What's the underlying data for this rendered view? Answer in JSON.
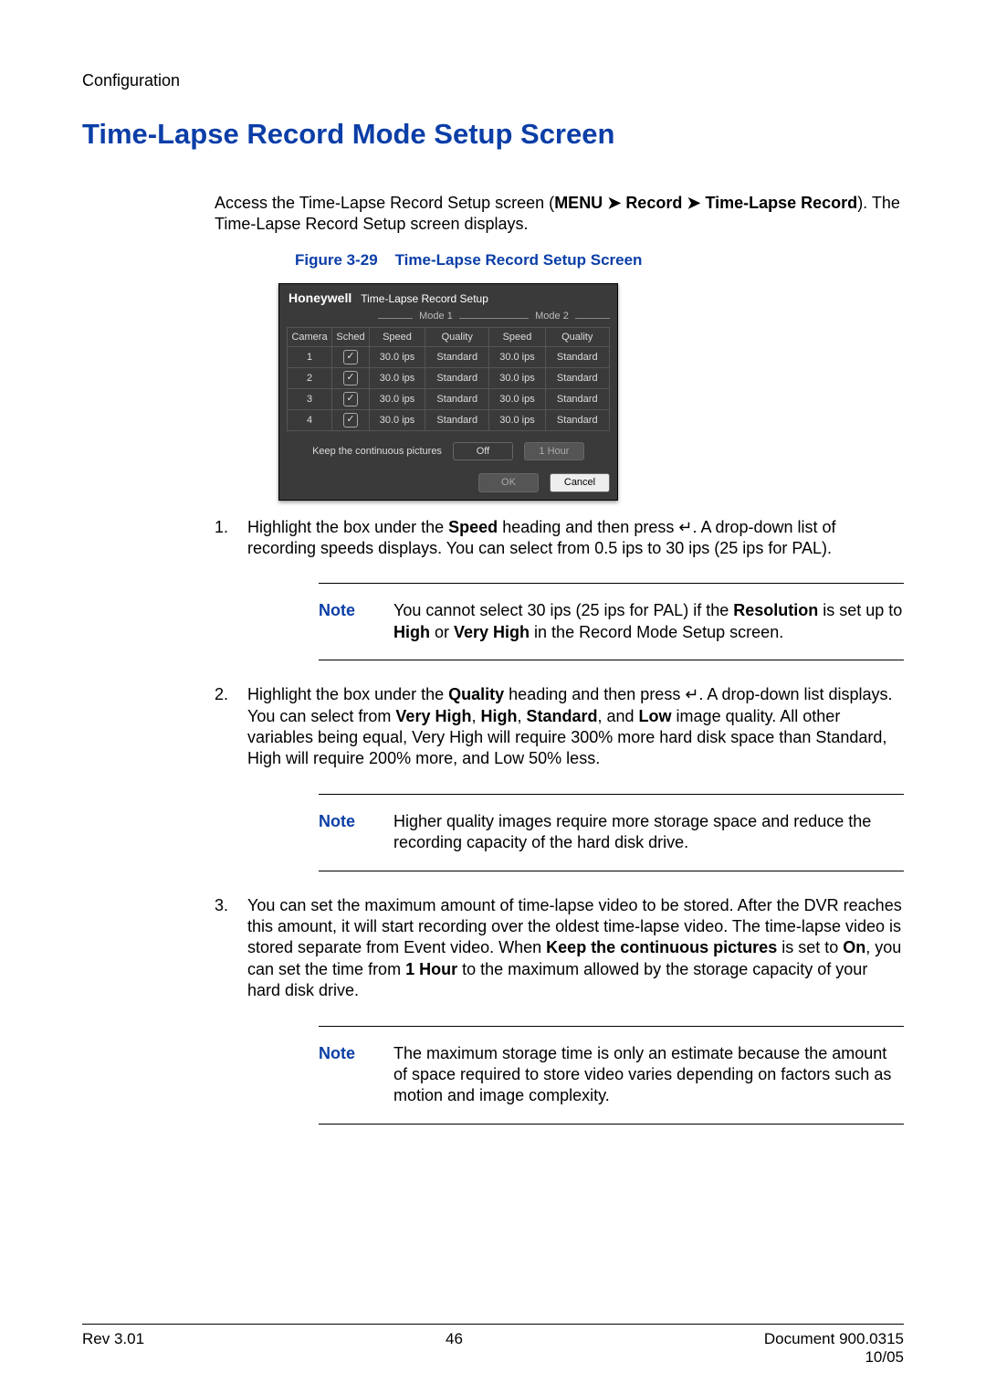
{
  "breadcrumb": "Configuration",
  "title": "Time-Lapse Record Mode Setup Screen",
  "intro_parts": {
    "a": "Access the Time-Lapse Record Setup screen (",
    "menu": "MENU",
    "arrow": "➤",
    "record": "Record",
    "tlr": "Time-Lapse Record",
    "b": "). The Time-Lapse Record Setup screen displays."
  },
  "figure": {
    "label": "Figure 3-29",
    "title": "Time-Lapse Record Setup Screen"
  },
  "shot": {
    "brand": "Honeywell",
    "window_title": "Time-Lapse Record Setup",
    "mode1": "Mode 1",
    "mode2": "Mode 2",
    "headers": {
      "camera": "Camera",
      "sched": "Sched",
      "speed": "Speed",
      "quality": "Quality"
    },
    "rows": [
      {
        "camera": "1",
        "sched": true,
        "m1_speed": "30.0 ips",
        "m1_quality": "Standard",
        "m2_speed": "30.0 ips",
        "m2_quality": "Standard"
      },
      {
        "camera": "2",
        "sched": true,
        "m1_speed": "30.0 ips",
        "m1_quality": "Standard",
        "m2_speed": "30.0 ips",
        "m2_quality": "Standard"
      },
      {
        "camera": "3",
        "sched": true,
        "m1_speed": "30.0 ips",
        "m1_quality": "Standard",
        "m2_speed": "30.0 ips",
        "m2_quality": "Standard"
      },
      {
        "camera": "4",
        "sched": true,
        "m1_speed": "30.0 ips",
        "m1_quality": "Standard",
        "m2_speed": "30.0 ips",
        "m2_quality": "Standard"
      }
    ],
    "keep_label": "Keep the continuous pictures",
    "keep_state": "Off",
    "keep_duration": "1 Hour",
    "ok": "OK",
    "cancel": "Cancel"
  },
  "steps": {
    "s1a": "Highlight the box under the ",
    "s1_speed": "Speed",
    "s1b": " heading and then press ",
    "enter_glyph": "↵",
    "s1c": ". A drop-down list of recording speeds displays. You can select from 0.5 ips to 30 ips (25 ips for PAL).",
    "s2a": "Highlight the box under the ",
    "s2_quality": "Quality",
    "s2b": " heading and then press ",
    "s2c": ". A drop-down list displays. You can select from ",
    "s2_vh": "Very High",
    "s2_h": "High",
    "s2_s": "Standard",
    "s2_l": "Low",
    "s2d": " image quality. All other variables being equal, Very High will require 300% more hard disk space than Standard, High will require 200% more, and Low 50% less.",
    "s3a": "You can set the maximum amount of time-lapse video to be stored. After the DVR reaches this amount, it will start recording over the oldest time-lapse video. The time-lapse video is stored separate from Event video. When ",
    "s3_kcp": "Keep the continuous pictures",
    "s3b": " is set to ",
    "s3_on": "On",
    "s3c": ", you can set the time from ",
    "s3_1h": "1 Hour",
    "s3d": " to the maximum allowed by the storage capacity of your hard disk drive."
  },
  "notes": {
    "label": "Note",
    "n1a": "You cannot select 30 ips (25 ips for PAL) if the ",
    "n1_res": "Resolution",
    "n1b": " is set up to ",
    "n1_h": "High",
    "n1_or": " or ",
    "n1_vh": "Very High",
    "n1c": " in the Record Mode Setup screen.",
    "n2": "Higher quality images require more storage space and reduce the recording capacity of the hard disk drive.",
    "n3": "The maximum storage time is only an estimate because the amount of space required to store video varies depending on factors such as motion and image complexity."
  },
  "footer": {
    "rev": "Rev 3.01",
    "page": "46",
    "doc": "Document 900.0315",
    "date": "10/05"
  },
  "comma": ", ",
  "and": ", and "
}
